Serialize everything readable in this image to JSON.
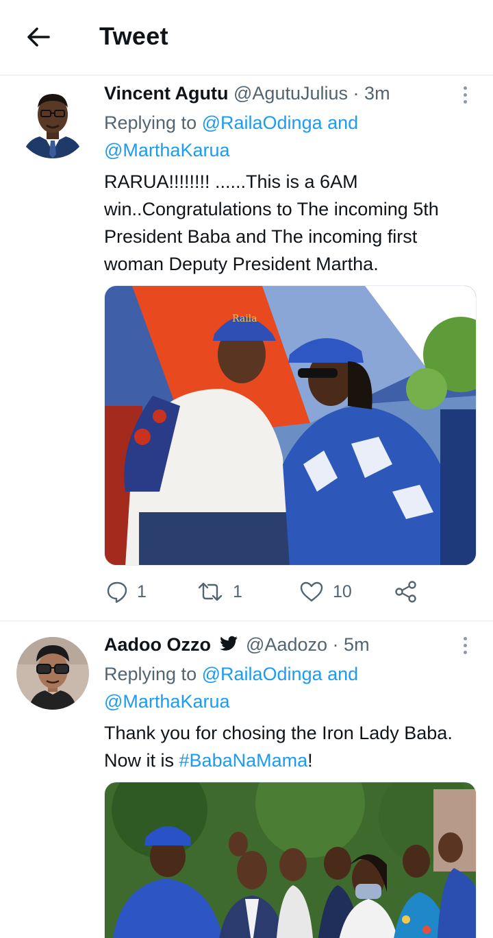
{
  "header": {
    "title": "Tweet",
    "back_icon": "arrow-left-icon"
  },
  "tweets": [
    {
      "author_name": "Vincent Agutu",
      "handle": "@AgutuJulius",
      "separator": "·",
      "time": "3m",
      "verified": false,
      "replying_to_prefix": "Replying to ",
      "mention_1": "@RailaOdinga",
      "mention_joiner": " and",
      "mention_2": "@MarthaKarua",
      "text": "RARUA!!!!!!!! ......This is a 6AM win..Congratulations to The  incoming 5th President Baba and The incoming first woman Deputy President Martha.",
      "actions": {
        "replies": "1",
        "retweets": "1",
        "likes": "10"
      }
    },
    {
      "author_name": "Aadoo Ozzo",
      "handle": "@Aadozo",
      "separator": "·",
      "time": "5m",
      "verified_icon": "twitter-bird-icon",
      "replying_to_prefix": "Replying to ",
      "mention_1": "@RailaOdinga",
      "mention_joiner": " and",
      "mention_2": "@MarthaKarua",
      "text_before": "Thank you for chosing the Iron Lady Baba. Now it is ",
      "hashtag": "#BabaNaMama",
      "text_after": "!"
    }
  ],
  "colors": {
    "link": "#1d9bf0",
    "secondary_text": "#536471",
    "divider": "#e6ecf0"
  }
}
